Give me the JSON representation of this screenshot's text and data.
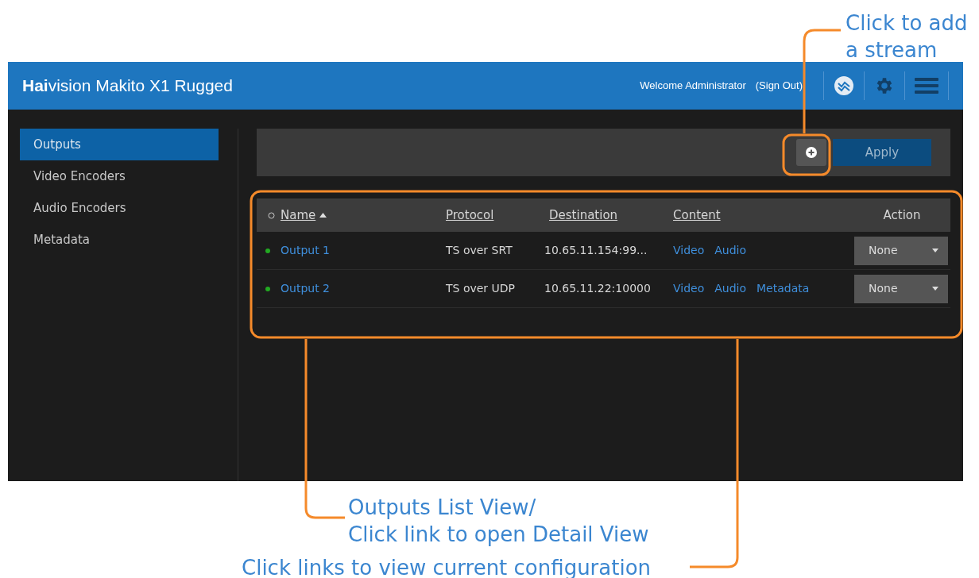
{
  "header": {
    "title": "**Hai**vision Makito X1 Rugged",
    "welcome": "Welcome Administrator",
    "sign_out": "(Sign Out)"
  },
  "sidebar": {
    "items": [
      {
        "label": "Outputs",
        "selected": true
      },
      {
        "label": "Video Encoders",
        "selected": false
      },
      {
        "label": "Audio Encoders",
        "selected": false
      },
      {
        "label": "Metadata",
        "selected": false
      }
    ]
  },
  "toolbar": {
    "apply": "Apply"
  },
  "table": {
    "columns": [
      "Name",
      "Protocol",
      "Destination",
      "Content",
      "Action"
    ],
    "rows": [
      {
        "color": "#22aa22",
        "name": "Output 1",
        "protocol": "TS over SRT",
        "destination": "10.65.11.154:99...",
        "content": [
          "Video",
          "Audio"
        ],
        "action": "None"
      },
      {
        "color": "#22aa22",
        "name": "Output 2",
        "protocol": "TS over UDP",
        "destination": "10.65.11.22:10000",
        "content": [
          "Video",
          "Audio",
          "Metadata"
        ],
        "action": "None"
      }
    ]
  },
  "callouts": [
    {
      "kind": "add",
      "lines": [
        "Click to add",
        "a stream"
      ]
    },
    {
      "kind": "list",
      "lines": [
        "Outputs List View/",
        "Click link to open Detail View"
      ]
    },
    {
      "kind": "links",
      "lines": [
        "Click links to view current configuration"
      ]
    }
  ]
}
